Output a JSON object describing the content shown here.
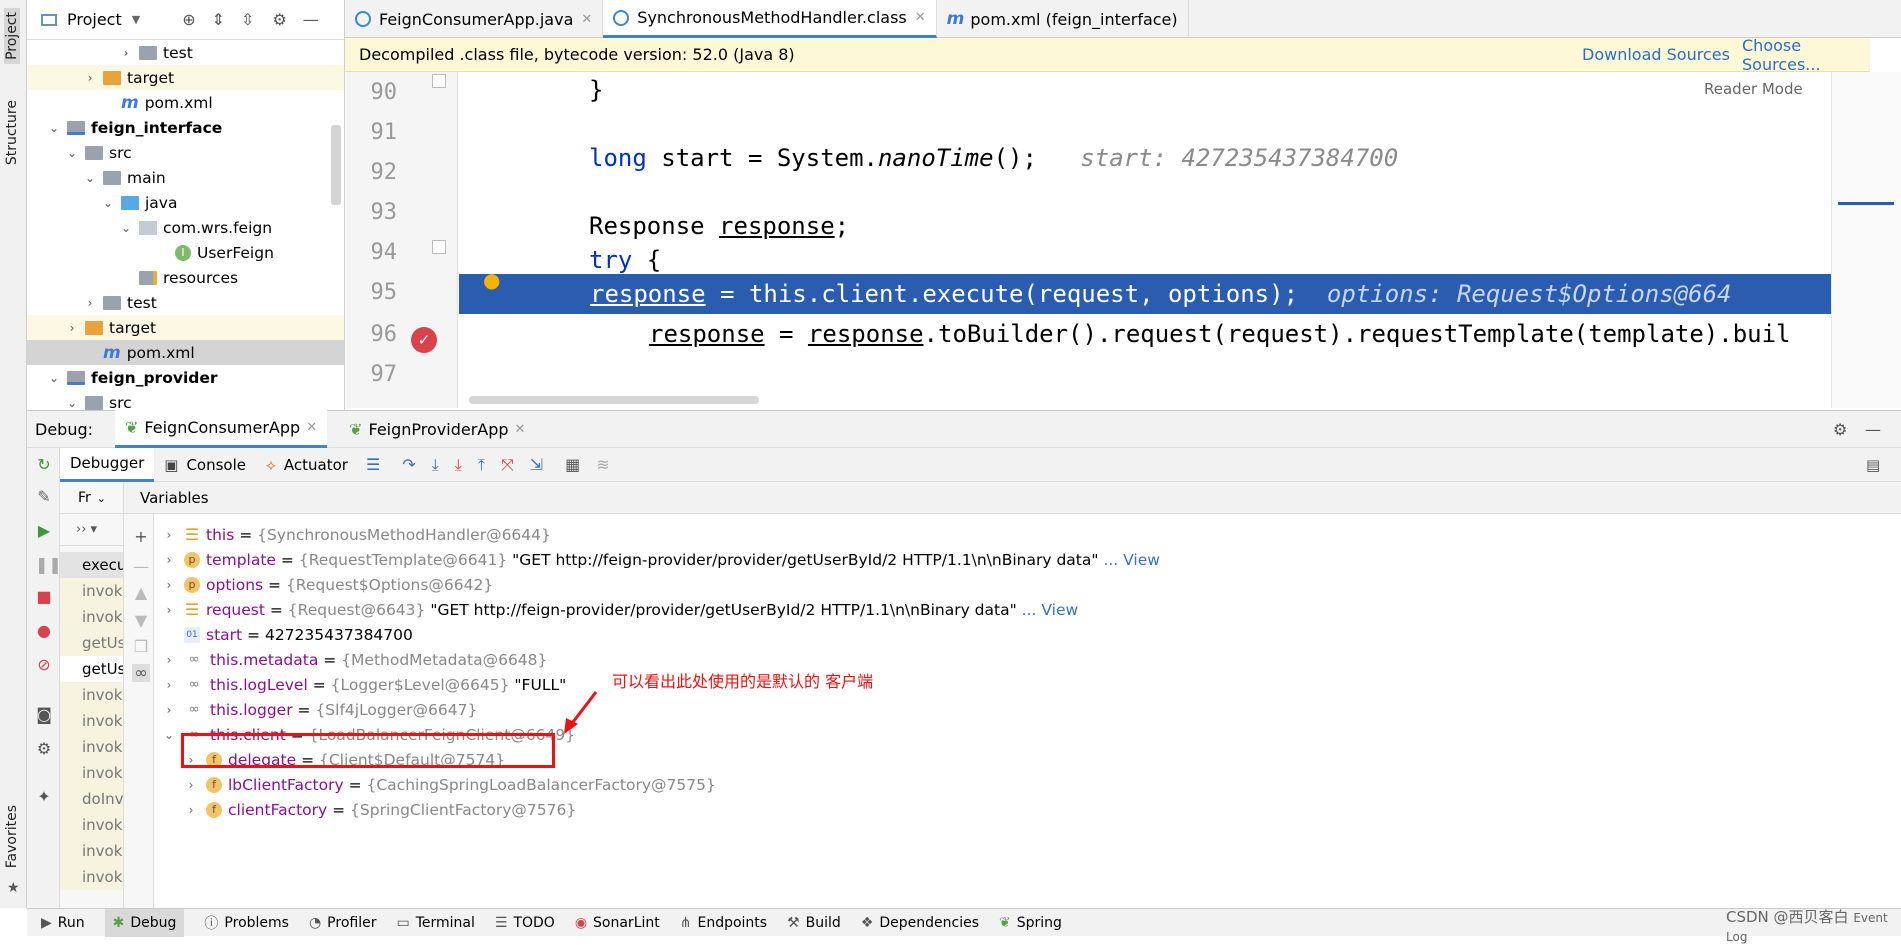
{
  "side": {
    "project": "Project",
    "structure": "Structure",
    "favorites": "Favorites"
  },
  "project": {
    "title": "Project",
    "tree": [
      {
        "label": "test",
        "kind": "gray",
        "indent": 5,
        "arrow": "›"
      },
      {
        "label": "target",
        "kind": "orange",
        "indent": 3,
        "arrow": "›",
        "bg": "target"
      },
      {
        "label": "pom.xml",
        "kind": "m",
        "indent": 4,
        "arrow": ""
      },
      {
        "label": "feign_interface",
        "kind": "module",
        "indent": 1,
        "arrow": "⌄",
        "bold": true
      },
      {
        "label": "src",
        "kind": "gray",
        "indent": 2,
        "arrow": "⌄"
      },
      {
        "label": "main",
        "kind": "gray",
        "indent": 3,
        "arrow": "⌄"
      },
      {
        "label": "java",
        "kind": "blue",
        "indent": 4,
        "arrow": "⌄"
      },
      {
        "label": "com.wrs.feign",
        "kind": "pkg",
        "indent": 5,
        "arrow": "⌄"
      },
      {
        "label": "UserFeign",
        "kind": "iface",
        "indent": 7,
        "arrow": ""
      },
      {
        "label": "resources",
        "kind": "res",
        "indent": 5,
        "arrow": ""
      },
      {
        "label": "test",
        "kind": "gray",
        "indent": 3,
        "arrow": "›"
      },
      {
        "label": "target",
        "kind": "orange",
        "indent": 2,
        "arrow": "›",
        "bg": "target"
      },
      {
        "label": "pom.xml",
        "kind": "m",
        "indent": 3,
        "arrow": "",
        "bg": "sel"
      },
      {
        "label": "feign_provider",
        "kind": "module",
        "indent": 1,
        "arrow": "⌄",
        "bold": true
      },
      {
        "label": "src",
        "kind": "gray",
        "indent": 2,
        "arrow": "⌄"
      }
    ]
  },
  "editor": {
    "tabs": [
      {
        "label": "FeignConsumerApp.java",
        "color": "#3d87c9",
        "active": false
      },
      {
        "label": "SynchronousMethodHandler.class",
        "color": "#3d87c9",
        "active": true
      },
      {
        "label": "pom.xml (feign_interface)",
        "color": "",
        "active": false
      }
    ],
    "banner": "Decompiled .class file, bytecode version: 52.0 (Java 8)",
    "download_sources": "Download Sources",
    "choose_sources": "Choose Sources...",
    "reader_mode": "Reader Mode",
    "line_numbers": [
      "90",
      "91",
      "92",
      "93",
      "94",
      "95",
      "96",
      "97"
    ],
    "lines": {
      "l90": "}",
      "l92_kw": "long",
      "l92_a": " start = System.",
      "l92_m": "nanoTime",
      "l92_b": "();",
      "l92_hint": "start: 427235437384700",
      "l94_a": "Response ",
      "l94_v": "response",
      "l94_b": ";",
      "l95_kw": "try",
      "l95_b": " {",
      "l96_v": "response",
      "l96_a": " = this.client.execute(request, options);",
      "l96_hint": "options: Request$Options@664",
      "l97_v": "response",
      "l97_a": " = ",
      "l97_v2": "response",
      "l97_b": ".toBuilder().request(request).requestTemplate(template).buil"
    }
  },
  "debug": {
    "label": "Debug:",
    "sessions": [
      "FeignConsumerApp",
      "FeignProviderApp"
    ],
    "subtabs": [
      "Debugger",
      "Console",
      "Actuator"
    ],
    "frames_dropdown": "Fr",
    "frames": [
      {
        "label": "execu",
        "style": "s"
      },
      {
        "label": "invok",
        "style": "y"
      },
      {
        "label": "invok",
        "style": "y"
      },
      {
        "label": "getUs",
        "style": "y"
      },
      {
        "label": "getUs",
        "style": "w"
      },
      {
        "label": "invok",
        "style": "y"
      },
      {
        "label": "invok",
        "style": "y"
      },
      {
        "label": "invok",
        "style": "y"
      },
      {
        "label": "invok",
        "style": "y"
      },
      {
        "label": "doInv",
        "style": "y"
      },
      {
        "label": "invok",
        "style": "y"
      },
      {
        "label": "invok",
        "style": "y"
      },
      {
        "label": "invok",
        "style": "y"
      }
    ],
    "variables_title": "Variables",
    "variables": [
      {
        "name": "this",
        "eq": " = ",
        "type": "{SynchronousMethodHandler@6644}",
        "val": "",
        "link": "",
        "badge": "bar",
        "level": 0,
        "arrow": "›"
      },
      {
        "name": "template",
        "eq": " = ",
        "type": "{RequestTemplate@6641}",
        "val": " \"GET http://feign-provider/provider/getUserById/2 HTTP/1.1\\n\\nBinary data\"",
        "link": " ... View",
        "badge": "p",
        "level": 0,
        "arrow": "›"
      },
      {
        "name": "options",
        "eq": " = ",
        "type": "{Request$Options@6642}",
        "val": "",
        "link": "",
        "badge": "p",
        "level": 0,
        "arrow": "›"
      },
      {
        "name": "request",
        "eq": " = ",
        "type": "{Request@6643}",
        "val": " \"GET http://feign-provider/provider/getUserById/2 HTTP/1.1\\n\\nBinary data\"",
        "link": " ... View",
        "badge": "bar",
        "level": 0,
        "arrow": "›"
      },
      {
        "name": "start",
        "eq": " = ",
        "type": "",
        "val": "427235437384700",
        "link": "",
        "badge": "n",
        "level": 0,
        "arrow": ""
      },
      {
        "name": "this.metadata",
        "eq": " = ",
        "type": "{MethodMetadata@6648}",
        "val": "",
        "link": "",
        "badge": "oo",
        "level": 0,
        "arrow": "›"
      },
      {
        "name": "this.logLevel",
        "eq": " = ",
        "type": "{Logger$Level@6645}",
        "val": " \"FULL\"",
        "link": "",
        "badge": "oo",
        "level": 0,
        "arrow": "›"
      },
      {
        "name": "this.logger",
        "eq": " = ",
        "type": "{Slf4jLogger@6647}",
        "val": "",
        "link": "",
        "badge": "oo",
        "level": 0,
        "arrow": "›"
      },
      {
        "name": "this.client",
        "eq": " = ",
        "type": "{LoadBalancerFeignClient@6649}",
        "val": "",
        "link": "",
        "badge": "oo",
        "level": 0,
        "arrow": "⌄"
      },
      {
        "name": "delegate",
        "eq": " = ",
        "type": "{Client$Default@7574}",
        "val": "",
        "link": "",
        "badge": "f",
        "level": 1,
        "arrow": "›"
      },
      {
        "name": "lbClientFactory",
        "eq": " = ",
        "type": "{CachingSpringLoadBalancerFactory@7575}",
        "val": "",
        "link": "",
        "badge": "f",
        "level": 1,
        "arrow": "›"
      },
      {
        "name": "clientFactory",
        "eq": " = ",
        "type": "{SpringClientFactory@7576}",
        "val": "",
        "link": "",
        "badge": "f",
        "level": 1,
        "arrow": "›"
      }
    ],
    "annotation": "可以看出此处使用的是默认的 客户端"
  },
  "status": {
    "items": [
      "Run",
      "Debug",
      "Problems",
      "Profiler",
      "Terminal",
      "TODO",
      "SonarLint",
      "Endpoints",
      "Build",
      "Dependencies",
      "Spring"
    ],
    "active": "Debug",
    "watermark": "CSDN @西贝客白",
    "event_log": "Event Log"
  }
}
